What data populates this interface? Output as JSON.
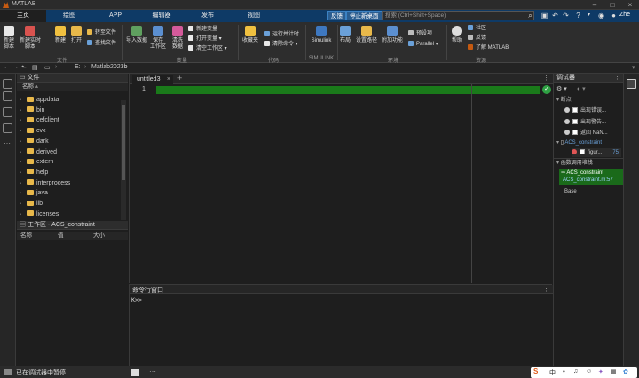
{
  "app": {
    "title": "MATLAB"
  },
  "tabs": [
    "主页",
    "绘图",
    "APP",
    "编辑器",
    "发布",
    "视图"
  ],
  "topbar": {
    "feedback": "反馈",
    "stop_sharing": "停止新桌面",
    "search_placeholder": "搜索 (Ctrl+Shift+Space)",
    "user": "Zhe"
  },
  "ribbon": {
    "groups": [
      "文件",
      "变量",
      "代码",
      "SIMULINK",
      "环境",
      "资源"
    ],
    "buttons": {
      "new_script": "新建\n脚本",
      "new_live_script": "新建实时脚本",
      "new": "新建",
      "open": "打开",
      "goto_file": "转至文件",
      "find_file": "查找文件",
      "import_data": "导入数据",
      "save_workspace": "保存\n工作区",
      "clean_data": "清洗\n数据",
      "new_variable": "新建变量",
      "open_variable": "打开变量",
      "clear_workspace": "清空工作区",
      "favorites": "收藏夹",
      "run_time": "运行并计时",
      "clear_commands": "清除命令",
      "simulink": "Simulink",
      "layout": "布局",
      "set_path": "设置路径",
      "addons": "附加功能",
      "preferences": "预设项",
      "parallel": "Parallel",
      "help": "帮助",
      "community": "社区",
      "feedback": "反馈",
      "learn_matlab": "了解 MATLAB"
    }
  },
  "address": {
    "path": [
      "E:",
      "Matlab2023b"
    ]
  },
  "file_panel": {
    "title": "文件",
    "col_name": "名称",
    "items": [
      "appdata",
      "bin",
      "cefclient",
      "cvx",
      "dark",
      "derived",
      "extern",
      "help",
      "interprocess",
      "java",
      "lib",
      "licenses"
    ]
  },
  "workspace": {
    "title": "工作区 - ACS_constraint",
    "cols": [
      "名称",
      "值",
      "大小"
    ]
  },
  "editor": {
    "tab": "untitled3",
    "line": "1"
  },
  "command_window": {
    "title": "命令行窗口",
    "prompt": "K>>"
  },
  "debugger": {
    "title": "调试器",
    "breakpoints_title": "断点",
    "bp_items": [
      "出现错误...",
      "出现警告...",
      "返回 NaN..."
    ],
    "file": "ACS_constraint",
    "file_item": "figur...",
    "file_item_line": "75",
    "stack_title": "函数调用堆栈",
    "stack_entry": "ACS_constraint",
    "stack_loc": "ACS_constraint.m:57",
    "stack_base": "Base"
  },
  "status": {
    "text": "已在调试器中暂停"
  },
  "tray": {
    "ime": "中"
  },
  "colors": {
    "accent_blue": "#0e3a66",
    "green_bar": "#1a7a1a",
    "folder": "#e8b84a"
  }
}
